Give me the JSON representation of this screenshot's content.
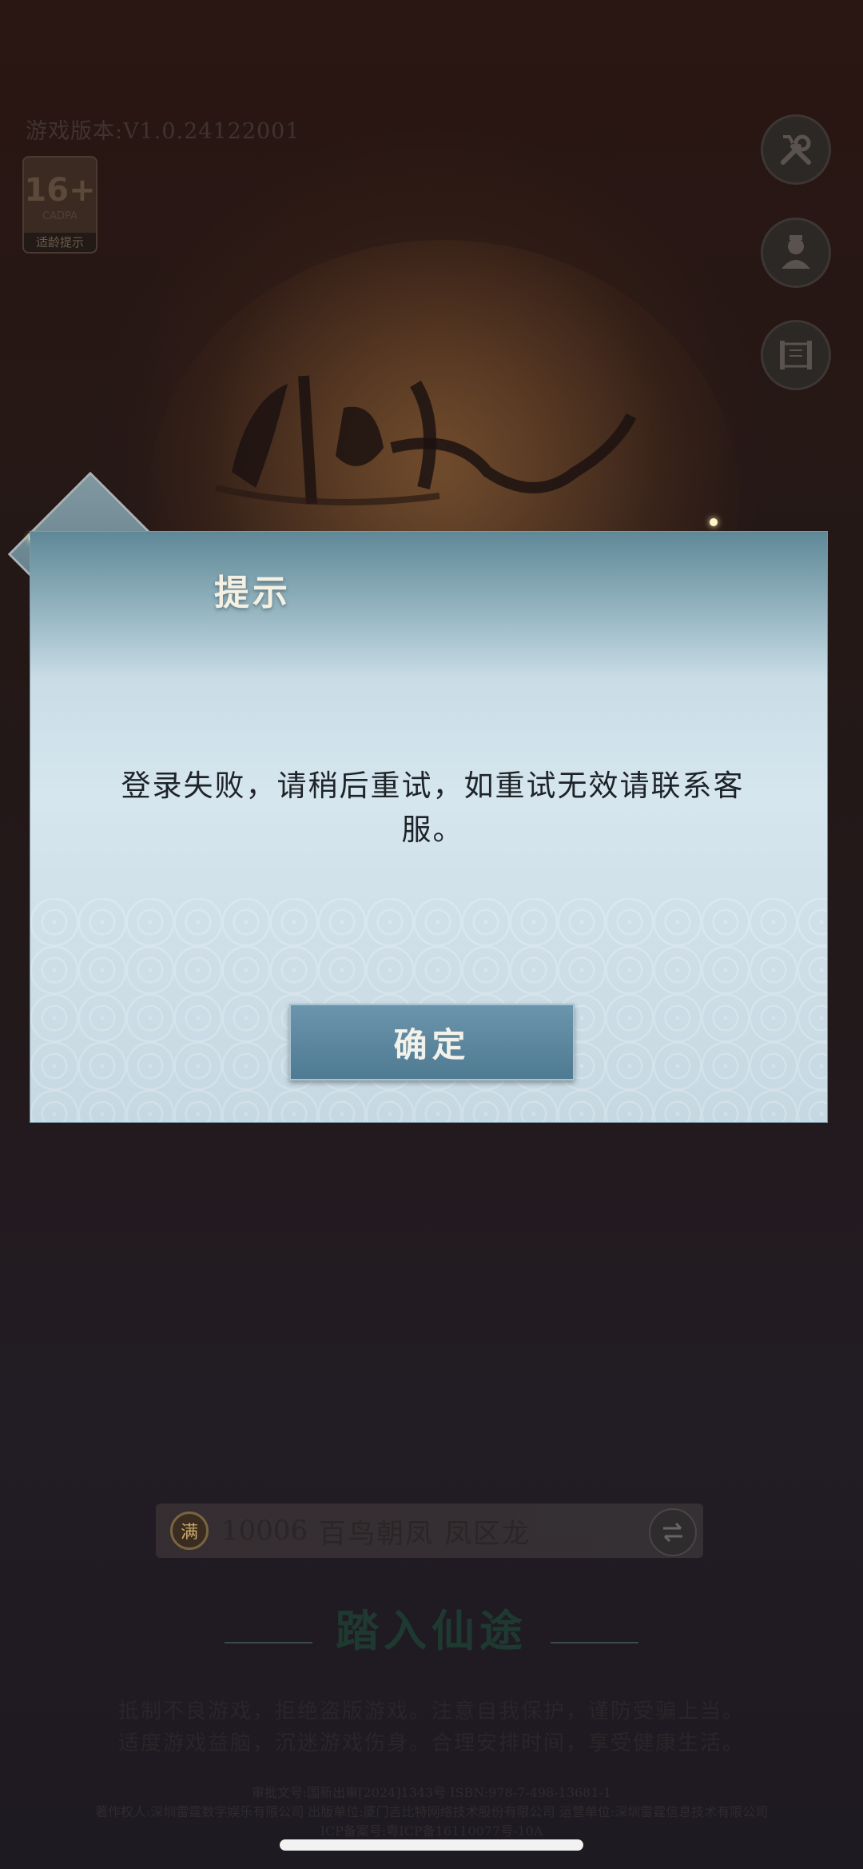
{
  "header": {
    "version_text": "游戏版本:V1.0.24122001",
    "age_rating": {
      "number": "16+",
      "org": "CADPA",
      "label": "适龄提示"
    }
  },
  "side_buttons": [
    {
      "icon": "wrench-screwdriver-icon"
    },
    {
      "icon": "character-portrait-icon"
    },
    {
      "icon": "scroll-icon"
    }
  ],
  "dialog": {
    "title": "提示",
    "message": "登录失败，请稍后重试，如重试无效请联系客服。",
    "confirm_label": "确定"
  },
  "server": {
    "badge": "满",
    "id": "10006",
    "name": "百鸟朝凤 凤区龙"
  },
  "enter_label": "踏入仙途",
  "notice": {
    "line1": "抵制不良游戏，拒绝盗版游戏。注意自我保护，谨防受骗上当。",
    "line2": "适度游戏益脑，沉迷游戏伤身。合理安排时间，享受健康生活。"
  },
  "legal": {
    "line1": "审批文号:国新出审[2024]1343号 ISBN:978-7-498-13681-1",
    "line2": "著作权人:深圳雷霆数字娱乐有限公司 出版单位:厦门吉比特网络技术股份有限公司 运营单位:深圳雷霆信息技术有限公司",
    "line3": "ICP备案号:粤ICP备16110077号-10A"
  }
}
